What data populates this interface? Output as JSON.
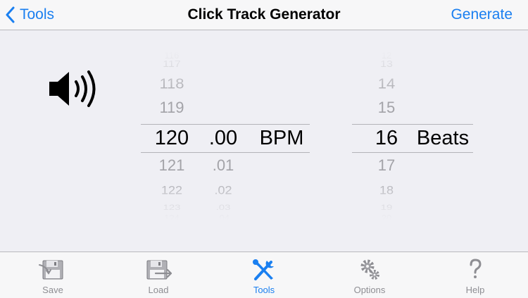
{
  "navbar": {
    "back_label": "Tools",
    "title": "Click Track Generator",
    "generate_label": "Generate"
  },
  "tempo_picker": {
    "bpm_rows": [
      "116",
      "117",
      "118",
      "119",
      "120",
      "121",
      "122",
      "123",
      "124"
    ],
    "fraction_rows": [
      "",
      "",
      "",
      "",
      ".00",
      ".01",
      ".02",
      ".03",
      ".04"
    ],
    "selected_bpm": "120",
    "selected_fraction": ".00",
    "unit_label": "BPM"
  },
  "beats_picker": {
    "rows": [
      "12",
      "13",
      "14",
      "15",
      "16",
      "17",
      "18",
      "19",
      "20"
    ],
    "selected": "16",
    "unit_label": "Beats"
  },
  "tabbar": {
    "items": [
      {
        "label": "Save",
        "icon": "save-icon"
      },
      {
        "label": "Load",
        "icon": "load-icon"
      },
      {
        "label": "Tools",
        "icon": "tools-icon",
        "active": true
      },
      {
        "label": "Options",
        "icon": "gears-icon"
      },
      {
        "label": "Help",
        "icon": "help-icon"
      }
    ]
  },
  "colors": {
    "accent": "#1a7ff0",
    "background": "#efeff4",
    "bar_background": "#f7f7f8",
    "inactive_text": "#8e8e93"
  }
}
